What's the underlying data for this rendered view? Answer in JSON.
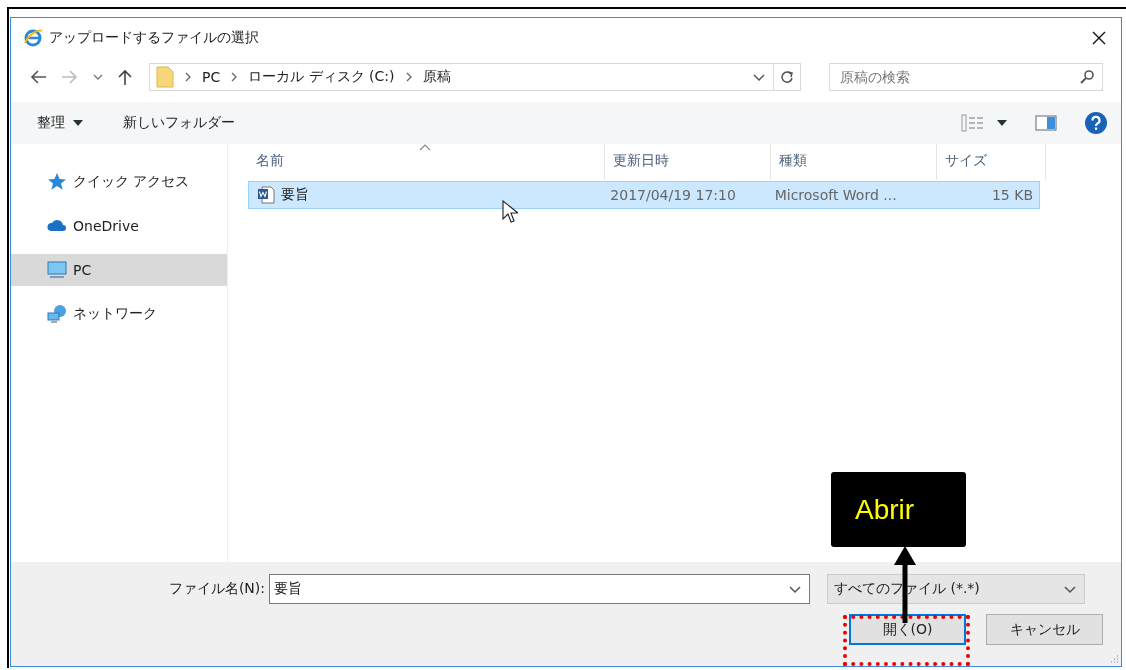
{
  "window": {
    "title": "アップロードするファイルの選択"
  },
  "address_bar": {
    "crumbs": [
      "PC",
      "ローカル ディスク (C:)",
      "原稿"
    ]
  },
  "search": {
    "placeholder": "原稿の検索"
  },
  "toolbar": {
    "organize": "整理",
    "new_folder": "新しいフォルダー"
  },
  "sidebar": {
    "items": [
      {
        "label": "クイック アクセス",
        "kind": "quick",
        "selected": false
      },
      {
        "label": "OneDrive",
        "kind": "cloud",
        "selected": false
      },
      {
        "label": "PC",
        "kind": "pc",
        "selected": true
      },
      {
        "label": "ネットワーク",
        "kind": "network",
        "selected": false
      }
    ]
  },
  "file_list": {
    "columns": [
      "名前",
      "更新日時",
      "種類",
      "サイズ"
    ],
    "rows": [
      {
        "name": "要旨",
        "modified": "2017/04/19 17:10",
        "type": "Microsoft Word ...",
        "size": "15 KB",
        "selected": true
      }
    ]
  },
  "footer": {
    "filename_label": "ファイル名(N):",
    "filename": "要旨",
    "filter": "すべてのファイル (*.*)",
    "open": "開く(O)",
    "cancel": "キャンセル"
  },
  "annotation": {
    "text": "Abrir"
  }
}
